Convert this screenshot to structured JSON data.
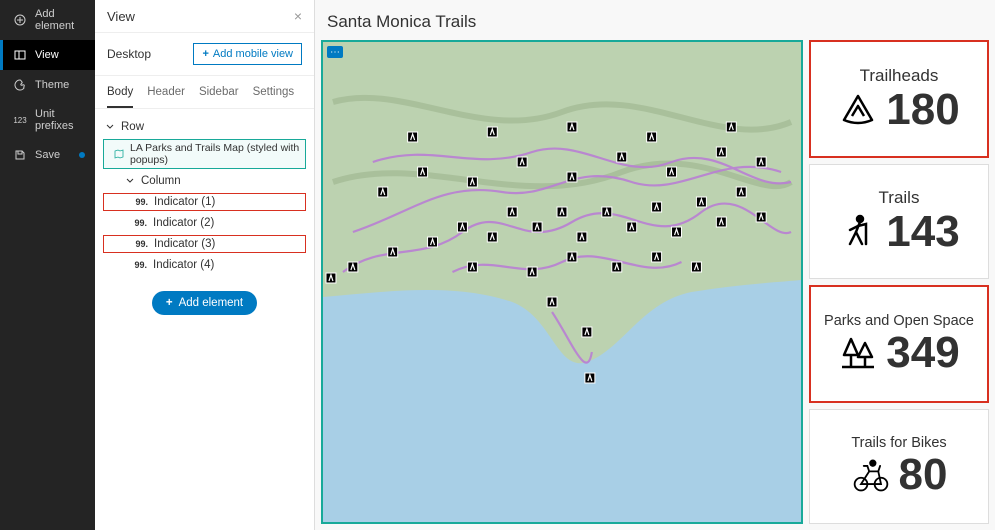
{
  "rail": {
    "items": [
      {
        "label": "Add element",
        "icon": "plus-circle"
      },
      {
        "label": "View",
        "icon": "layout",
        "active": true
      },
      {
        "label": "Theme",
        "icon": "palette"
      },
      {
        "label": "Unit prefixes",
        "icon": "one-two-three"
      },
      {
        "label": "Save",
        "icon": "save",
        "dirty": true
      }
    ]
  },
  "panel": {
    "title": "View",
    "mode_label": "Desktop",
    "mobile_btn": "Add mobile view",
    "tabs": [
      "Body",
      "Header",
      "Sidebar",
      "Settings"
    ],
    "active_tab": 0,
    "tree": {
      "row_label": "Row",
      "map_label": "LA Parks and Trails Map (styled with popups)",
      "column_label": "Column",
      "indicators": [
        {
          "label": "Indicator (1)",
          "red": true
        },
        {
          "label": "Indicator (2)",
          "red": false
        },
        {
          "label": "Indicator (3)",
          "red": true
        },
        {
          "label": "Indicator (4)",
          "red": false
        }
      ]
    },
    "add_element_btn": "Add element"
  },
  "canvas": {
    "title": "Santa Monica Trails",
    "indicators": [
      {
        "title": "Trailheads",
        "value": "180",
        "icon": "trailhead",
        "red": true
      },
      {
        "title": "Trails",
        "value": "143",
        "icon": "hiker",
        "red": false
      },
      {
        "title": "Parks and Open Space",
        "value": "349",
        "icon": "trees",
        "red": true
      },
      {
        "title": "Trails for Bikes",
        "value": "80",
        "icon": "bike",
        "red": false
      }
    ]
  }
}
